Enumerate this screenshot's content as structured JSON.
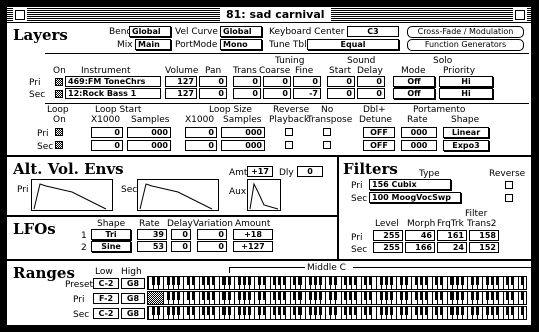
{
  "window": {
    "title": "81: sad carnival"
  },
  "layers": {
    "heading": "Layers",
    "bend_label": "Bend",
    "bend_value": "Global",
    "vel_curve_label": "Vel Curve",
    "vel_curve_value": "Global",
    "mix_label": "Mix",
    "mix_value": "Main",
    "port_mode_label": "PortMode",
    "port_mode_value": "Mono",
    "keyboard_center_label": "Keyboard Center",
    "keyboard_center_value": "C3",
    "tune_tbl_label": "Tune Tbl",
    "tune_tbl_value": "Equal",
    "btn_crossfade": "Cross-Fade / Modulation",
    "btn_function_gen": "Function Generators",
    "group_tuning": "Tuning",
    "group_sound": "Sound",
    "group_solo": "Solo",
    "cols": {
      "on": "On",
      "instrument": "Instrument",
      "volume": "Volume",
      "pan": "Pan",
      "trans": "Trans",
      "coarse": "Coarse",
      "fine": "Fine",
      "start": "Start",
      "delay": "Delay",
      "mode": "Mode",
      "priority": "Priority"
    },
    "rows": [
      {
        "label": "Pri",
        "on": true,
        "instrument": "469:FM ToneChrs",
        "volume": "127",
        "pan": "0",
        "trans": "0",
        "coarse": "0",
        "fine": "0",
        "start": "0",
        "delay": "0",
        "mode": "Off",
        "priority": "Hi"
      },
      {
        "label": "Sec",
        "on": true,
        "instrument": "12:Rock Bass 1",
        "volume": "127",
        "pan": "0",
        "trans": "0",
        "coarse": "0",
        "fine": "-7",
        "start": "0",
        "delay": "0",
        "mode": "Off",
        "priority": "Hi"
      }
    ],
    "loop": {
      "h_loop": "Loop",
      "h_on": "On",
      "h_loopstart": "Loop Start",
      "h_x1000a": "X1000",
      "h_samplesa": "Samples",
      "h_loopsize": "Loop Size",
      "h_x1000b": "X1000",
      "h_samplesb": "Samples",
      "h_reverse": "Reverse",
      "h_playback": "Playback",
      "h_no": "No",
      "h_transpose": "Transpose",
      "h_dbl": "Dbl+",
      "h_detune": "Detune",
      "h_portamento": "Portamento",
      "h_rate": "Rate",
      "h_shape": "Shape",
      "rows": [
        {
          "label": "Pri",
          "on": true,
          "start_x1000": "0",
          "start_samples": "000",
          "size_x1000": "0",
          "size_samples": "000",
          "reverse": false,
          "no_transpose": false,
          "detune": "OFF",
          "rate": "000",
          "shape": "Linear"
        },
        {
          "label": "Sec",
          "on": true,
          "start_x1000": "0",
          "start_samples": "000",
          "size_x1000": "0",
          "size_samples": "000",
          "reverse": false,
          "no_transpose": false,
          "detune": "OFF",
          "rate": "000",
          "shape": "Expo3"
        }
      ]
    }
  },
  "envs": {
    "heading": "Alt. Vol. Envs",
    "pri": "Pri",
    "sec": "Sec",
    "amt_label": "Amt",
    "amt_value": "+17",
    "dly_label": "Dly",
    "dly_value": "0",
    "aux": "Aux"
  },
  "lfos": {
    "heading": "LFOs",
    "h_shape": "Shape",
    "h_rate": "Rate",
    "h_delay": "Delay",
    "h_variation": "Variation",
    "h_amount": "Amount",
    "rows": [
      {
        "n": "1",
        "shape": "Tri",
        "rate": "39",
        "delay": "0",
        "variation": "0",
        "amount": "+18"
      },
      {
        "n": "2",
        "shape": "Sine",
        "rate": "53",
        "delay": "0",
        "variation": "0",
        "amount": "+127"
      }
    ]
  },
  "filters": {
    "heading": "Filters",
    "h_type": "Type",
    "h_reverse": "Reverse",
    "h_filter": "Filter",
    "h_level": "Level",
    "h_morph": "Morph",
    "h_frqtrk": "FrqTrk",
    "h_trans2": "Trans2",
    "rows": [
      {
        "label": "Pri",
        "type": "156 Cubix",
        "reverse": false,
        "level": "255",
        "morph": "46",
        "frqtrk": "161",
        "trans2": "158"
      },
      {
        "label": "Sec",
        "type": "100 MoogVocSwp",
        "reverse": false,
        "level": "255",
        "morph": "166",
        "frqtrk": "24",
        "trans2": "152"
      }
    ]
  },
  "ranges": {
    "heading": "Ranges",
    "h_low": "Low",
    "h_high": "High",
    "middle_c": "Middle C",
    "rows": [
      {
        "label": "Preset",
        "low": "C-2",
        "high": "G8"
      },
      {
        "label": "Pri",
        "low": "F-2",
        "high": "G8"
      },
      {
        "label": "Sec",
        "low": "C-2",
        "high": "G8"
      }
    ]
  }
}
